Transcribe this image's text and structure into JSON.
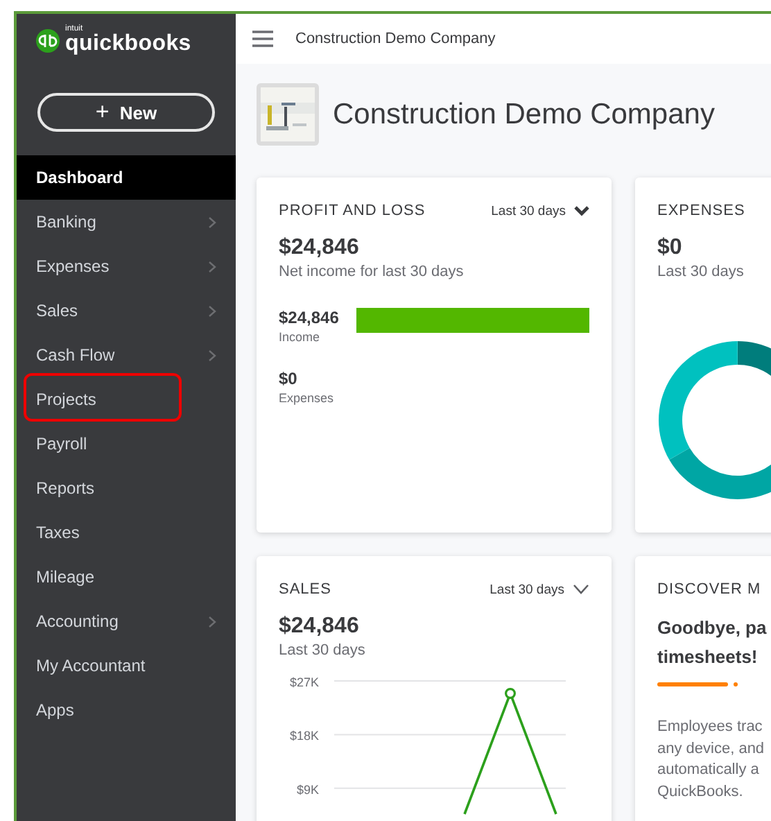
{
  "logo": {
    "brand_small": "intuit",
    "brand": "quickbooks"
  },
  "new_button": {
    "icon": "+",
    "label": "New"
  },
  "sidebar": {
    "items": [
      {
        "label": "Dashboard",
        "selected": true,
        "has_submenu": false,
        "annotated": false
      },
      {
        "label": "Banking",
        "selected": false,
        "has_submenu": true,
        "annotated": false
      },
      {
        "label": "Expenses",
        "selected": false,
        "has_submenu": true,
        "annotated": false
      },
      {
        "label": "Sales",
        "selected": false,
        "has_submenu": true,
        "annotated": false
      },
      {
        "label": "Cash Flow",
        "selected": false,
        "has_submenu": true,
        "annotated": false
      },
      {
        "label": "Projects",
        "selected": false,
        "has_submenu": false,
        "annotated": true
      },
      {
        "label": "Payroll",
        "selected": false,
        "has_submenu": false,
        "annotated": false
      },
      {
        "label": "Reports",
        "selected": false,
        "has_submenu": false,
        "annotated": false
      },
      {
        "label": "Taxes",
        "selected": false,
        "has_submenu": false,
        "annotated": false
      },
      {
        "label": "Mileage",
        "selected": false,
        "has_submenu": false,
        "annotated": false
      },
      {
        "label": "Accounting",
        "selected": false,
        "has_submenu": true,
        "annotated": false
      },
      {
        "label": "My Accountant",
        "selected": false,
        "has_submenu": false,
        "annotated": false
      },
      {
        "label": "Apps",
        "selected": false,
        "has_submenu": false,
        "annotated": false
      }
    ]
  },
  "header": {
    "company": "Construction Demo Company"
  },
  "company_title": "Construction Demo Company",
  "profit_and_loss": {
    "title": "PROFIT AND LOSS",
    "period": "Last 30 days",
    "amount": "$24,846",
    "caption": "Net income for last 30 days",
    "rows": [
      {
        "kind": "bar",
        "amount": "$24,846",
        "label": "Income"
      },
      {
        "kind": "plain",
        "amount": "$0",
        "label": "Expenses"
      }
    ]
  },
  "expenses": {
    "title": "EXPENSES",
    "amount": "$0",
    "caption": "Last 30 days"
  },
  "sales": {
    "title": "SALES",
    "period": "Last 30 days",
    "amount": "$24,846",
    "caption": "Last 30 days",
    "axis_labels": [
      "$27K",
      "$18K",
      "$9K"
    ]
  },
  "discover": {
    "title": "DISCOVER M",
    "headline_lines": [
      "Goodbye, pa",
      "timesheets!"
    ],
    "body_lines": [
      "Employees trac",
      "any device, and",
      "automatically a",
      "QuickBooks."
    ]
  }
}
